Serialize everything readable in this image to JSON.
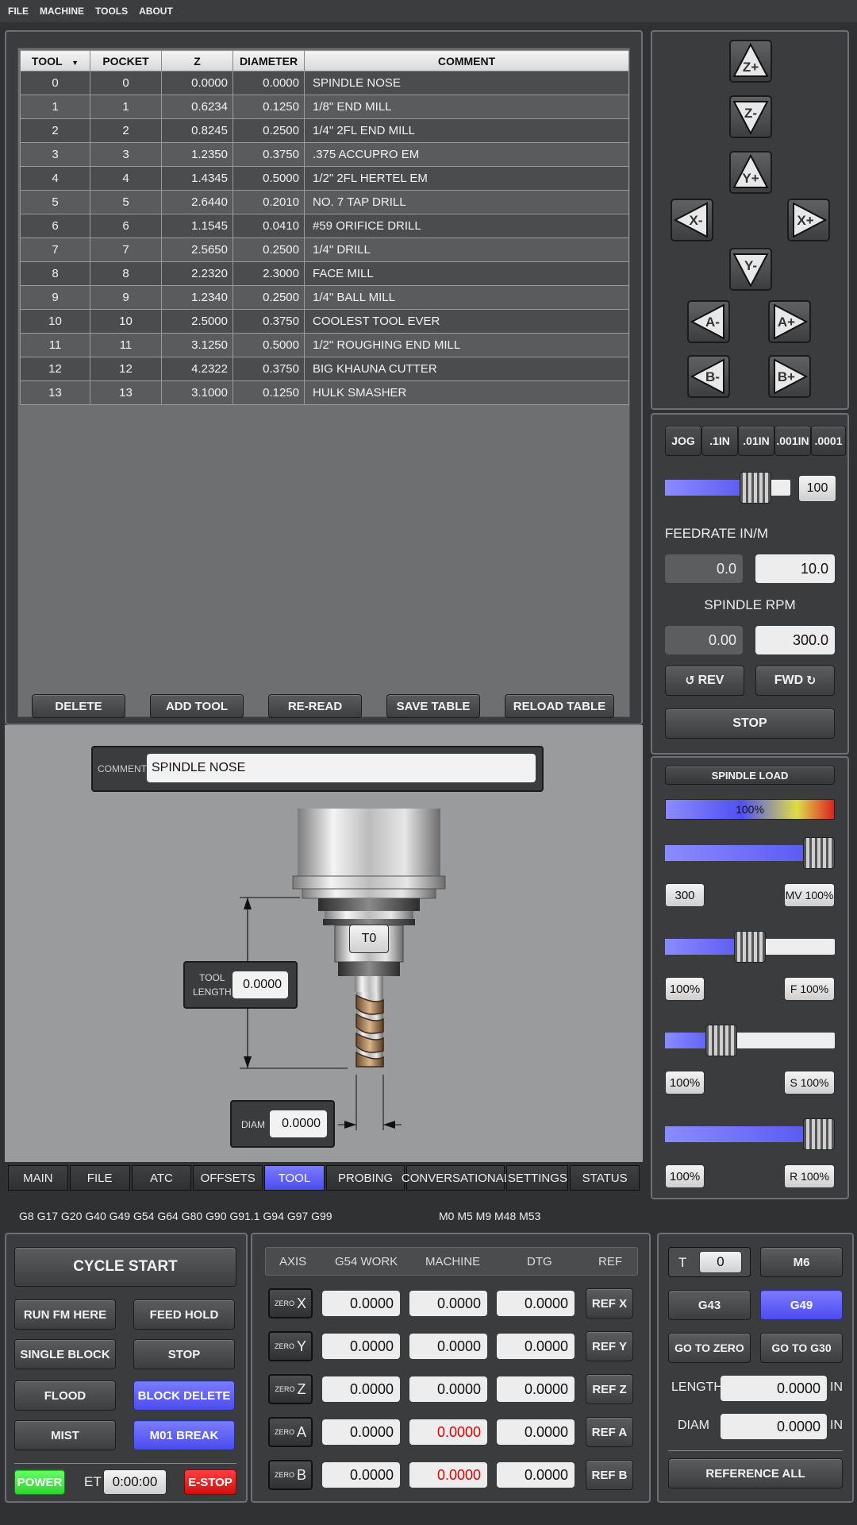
{
  "menu": [
    "FILE",
    "MACHINE",
    "TOOLS",
    "ABOUT"
  ],
  "table": {
    "headers": [
      "TOOL",
      "POCKET",
      "Z",
      "DIAMETER",
      "COMMENT"
    ],
    "rows": [
      [
        "0",
        "0",
        "0.0000",
        "0.0000",
        "SPINDLE NOSE"
      ],
      [
        "1",
        "1",
        "0.6234",
        "0.1250",
        "1/8\" END MILL"
      ],
      [
        "2",
        "2",
        "0.8245",
        "0.2500",
        "1/4\" 2FL END MILL"
      ],
      [
        "3",
        "3",
        "1.2350",
        "0.3750",
        ".375 ACCUPRO EM"
      ],
      [
        "4",
        "4",
        "1.4345",
        "0.5000",
        "1/2\" 2FL HERTEL EM"
      ],
      [
        "5",
        "5",
        "2.6440",
        "0.2010",
        "NO. 7 TAP DRILL"
      ],
      [
        "6",
        "6",
        "1.1545",
        "0.0410",
        "#59 ORIFICE DRILL"
      ],
      [
        "7",
        "7",
        "2.5650",
        "0.2500",
        "1/4\" DRILL"
      ],
      [
        "8",
        "8",
        "2.2320",
        "2.3000",
        "FACE MILL"
      ],
      [
        "9",
        "9",
        "1.2340",
        "0.2500",
        "1/4\" BALL MILL"
      ],
      [
        "10",
        "10",
        "2.5000",
        "0.3750",
        "COOLEST TOOL EVER"
      ],
      [
        "11",
        "11",
        "3.1250",
        "0.5000",
        "1/2\" ROUGHING END MILL"
      ],
      [
        "12",
        "12",
        "4.2322",
        "0.3750",
        "BIG KHAUNA CUTTER"
      ],
      [
        "13",
        "13",
        "3.1000",
        "0.1250",
        "HULK SMASHER"
      ]
    ]
  },
  "table_buttons": {
    "delete": "DELETE",
    "add": "ADD TOOL",
    "reread": "RE-READ",
    "save": "SAVE TABLE",
    "reload": "RELOAD TABLE"
  },
  "illus": {
    "comment_label": "COMMENT",
    "comment_value": "SPINDLE NOSE",
    "tool_label": "T0",
    "length_label_1": "TOOL",
    "length_label_2": "LENGTH",
    "length_value": "0.0000",
    "diam_label": "DIAM",
    "diam_value": "0.0000"
  },
  "tabs": [
    "MAIN",
    "FILE",
    "ATC",
    "OFFSETS",
    "TOOL",
    "PROBING",
    "CONVERSATIONAL",
    "SETTINGS",
    "STATUS"
  ],
  "gcodes": "G8 G17 G20 G40 G49 G54 G64 G80 G90 G91.1 G94 G97 G99",
  "mcodes": "M0 M5 M9 M48 M53",
  "jog": {
    "zp": "Z+",
    "zm": "Z-",
    "yp": "Y+",
    "ym": "Y-",
    "xm": "X-",
    "xp": "X+",
    "am": "A-",
    "ap": "A+",
    "bm": "B-",
    "bp": "B+"
  },
  "jog_increments": [
    "JOG",
    ".1IN",
    ".01IN",
    ".001IN",
    ".0001"
  ],
  "jog_speed": {
    "value": "100",
    "level": 0.72
  },
  "feed": {
    "label": "FEEDRATE IN/M",
    "actual": "0.0",
    "set": "10.0"
  },
  "spindle": {
    "label": "SPINDLE RPM",
    "actual": "0.00",
    "set": "300.0",
    "rev": "REV",
    "fwd": "FWD",
    "stop": "STOP"
  },
  "load": {
    "title": "SPINDLE LOAD",
    "bar_text": "100%"
  },
  "overrides": [
    {
      "left": "300",
      "right": "MV 100%",
      "level": 0.93
    },
    {
      "left": "100%",
      "right": "F 100%",
      "level": 0.5
    },
    {
      "left": "100%",
      "right": "S 100%",
      "level": 0.33
    },
    {
      "left": "100%",
      "right": "R 100%",
      "level": 0.93
    }
  ],
  "cycle": {
    "start": "CYCLE START",
    "run_here": "RUN FM HERE",
    "feed_hold": "FEED HOLD",
    "single": "SINGLE BLOCK",
    "stop": "STOP",
    "flood": "FLOOD",
    "block_delete": "BLOCK DELETE",
    "mist": "MIST",
    "m01": "M01 BREAK",
    "power": "POWER",
    "et_label": "ET",
    "et_value": "0:00:00",
    "estop": "E-STOP"
  },
  "dro": {
    "headers": [
      "AXIS",
      "G54 WORK",
      "MACHINE",
      "DTG",
      "REF"
    ],
    "zero_small": "ZERO",
    "axes": [
      {
        "axis": "X",
        "work": "0.0000",
        "machine": "0.0000",
        "dtg": "0.0000",
        "ref": "REF X"
      },
      {
        "axis": "Y",
        "work": "0.0000",
        "machine": "0.0000",
        "dtg": "0.0000",
        "ref": "REF Y"
      },
      {
        "axis": "Z",
        "work": "0.0000",
        "machine": "0.0000",
        "dtg": "0.0000",
        "ref": "REF Z"
      },
      {
        "axis": "A",
        "work": "0.0000",
        "machine": "0.0000",
        "dtg": "0.0000",
        "ref": "REF A"
      },
      {
        "axis": "B",
        "work": "0.0000",
        "machine": "0.0000",
        "dtg": "0.0000",
        "ref": "REF B"
      }
    ]
  },
  "toolinfo": {
    "t_label": "T",
    "t_value": "0",
    "m6": "M6",
    "g43": "G43",
    "g49": "G49",
    "go_zero": "GO TO ZERO",
    "go_g30": "GO TO G30",
    "length_label": "LENGTH",
    "length_value": "0.0000",
    "diam_label": "DIAM",
    "diam_value": "0.0000",
    "unit": "IN",
    "ref_all": "REFERENCE ALL"
  },
  "colors": {
    "accent": "#5c5cf4",
    "power": "#44ee44",
    "estop": "#e81818",
    "bg": "#2f3133"
  }
}
